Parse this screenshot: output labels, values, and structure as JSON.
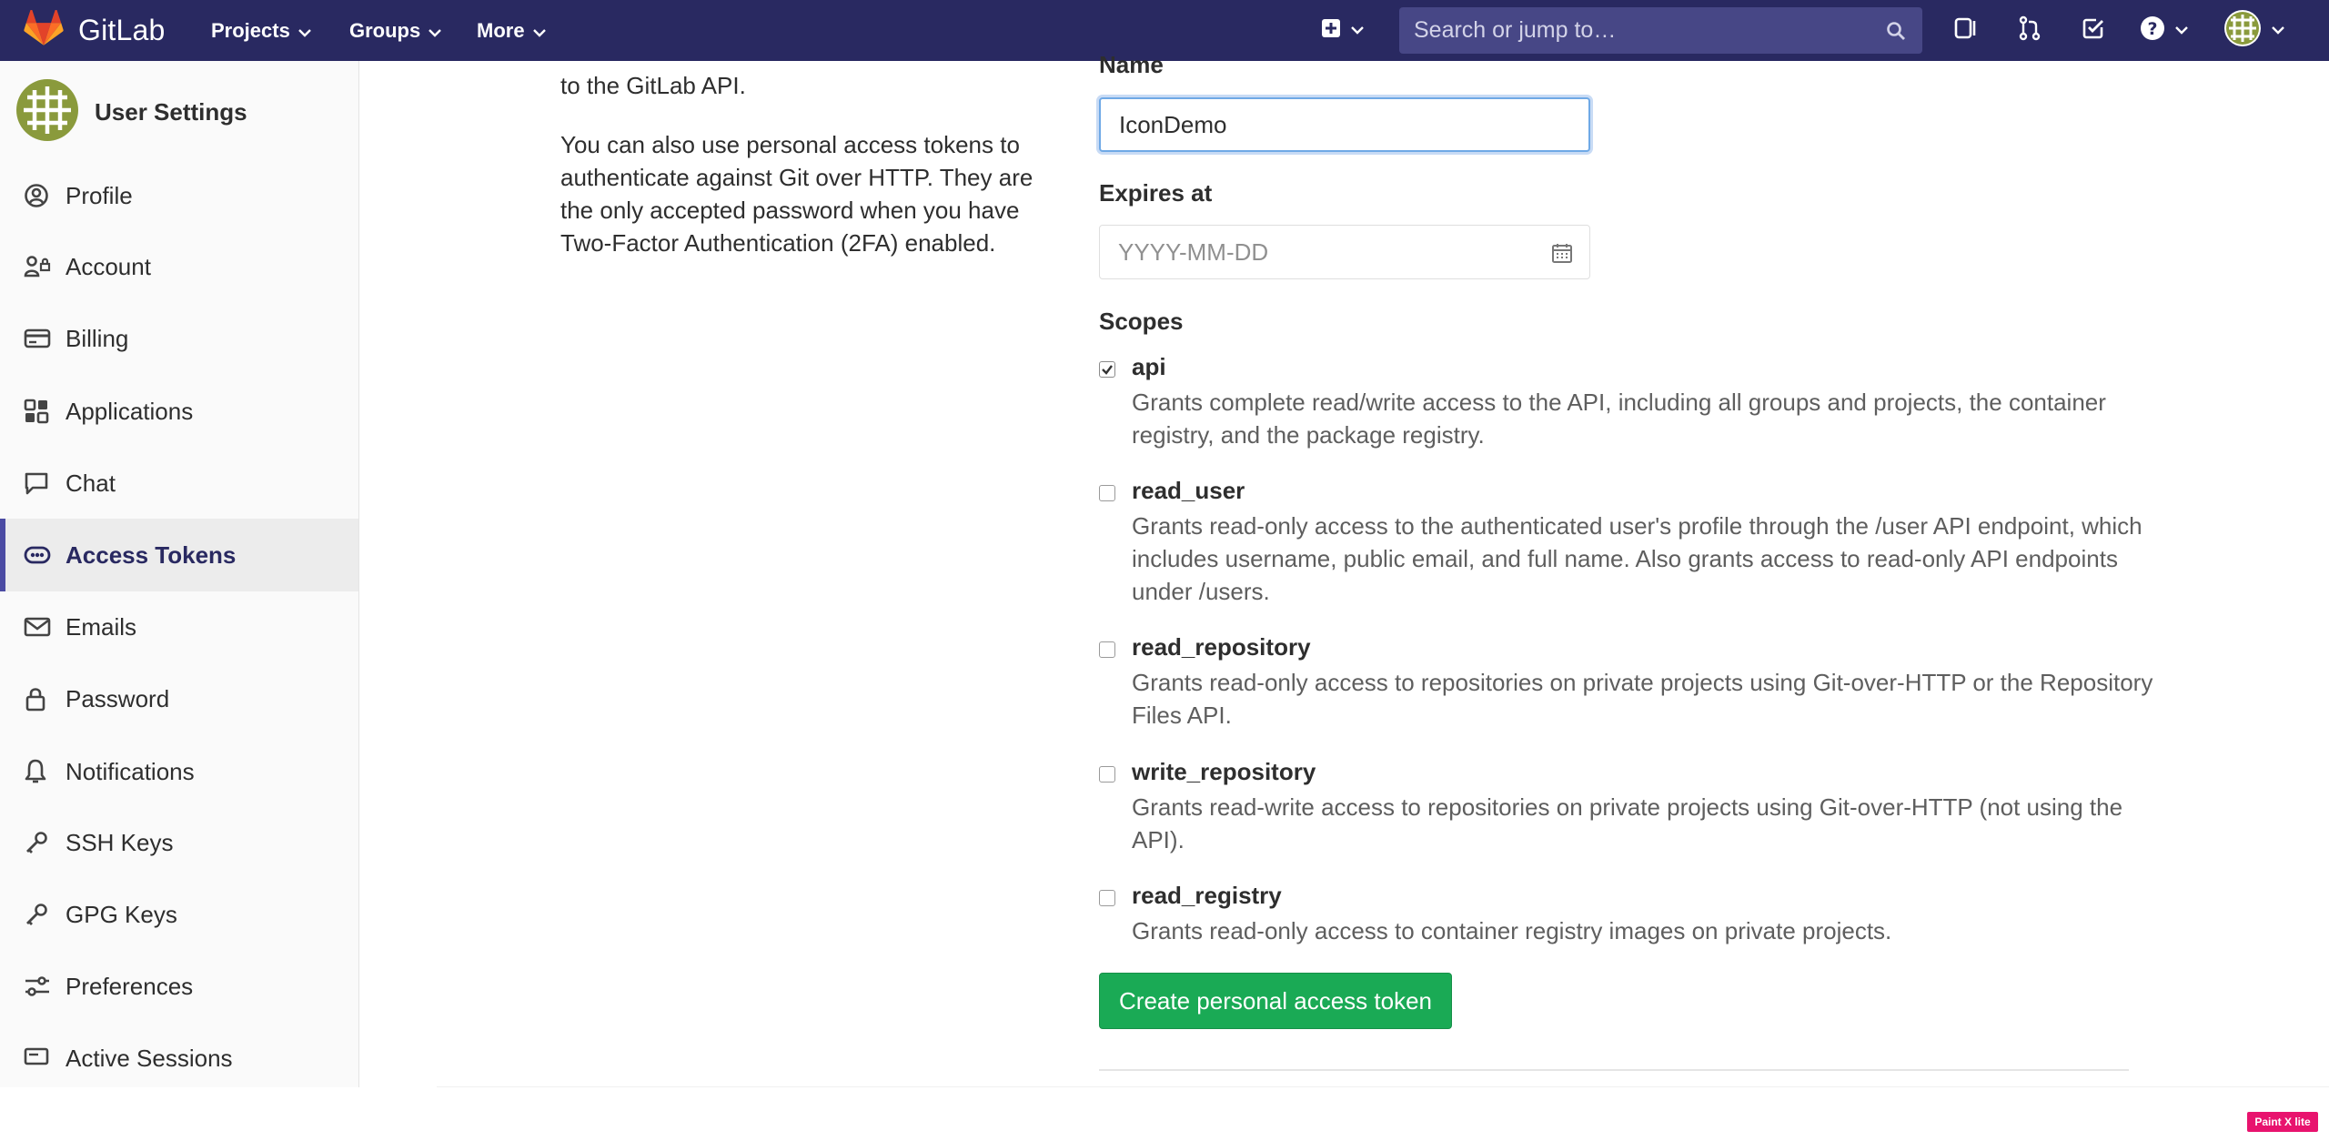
{
  "navbar": {
    "logo_text": "GitLab",
    "projects_label": "Projects",
    "groups_label": "Groups",
    "more_label": "More",
    "search_placeholder": "Search or jump to…",
    "icons": [
      "plus-square-icon",
      "chevron-down-icon",
      "search-icon",
      "sidebar-toggle-icon",
      "merge-request-icon",
      "todo-check-icon",
      "question-icon",
      "user-avatar"
    ],
    "bg_color": "#292961"
  },
  "sidebar": {
    "title": "User Settings",
    "items": [
      {
        "label": "Profile",
        "icon": "profile-icon"
      },
      {
        "label": "Account",
        "icon": "account-icon"
      },
      {
        "label": "Billing",
        "icon": "credit-card-icon"
      },
      {
        "label": "Applications",
        "icon": "applications-icon"
      },
      {
        "label": "Chat",
        "icon": "comment-icon"
      },
      {
        "label": "Access Tokens",
        "icon": "token-icon",
        "active": true
      },
      {
        "label": "Emails",
        "icon": "envelope-icon"
      },
      {
        "label": "Password",
        "icon": "lock-icon"
      },
      {
        "label": "Notifications",
        "icon": "bell-icon"
      },
      {
        "label": "SSH Keys",
        "icon": "key-icon"
      },
      {
        "label": "GPG Keys",
        "icon": "key-icon"
      },
      {
        "label": "Preferences",
        "icon": "preferences-icon"
      },
      {
        "label": "Active Sessions",
        "icon": "monitor-icon"
      }
    ],
    "active_color": "#4b4ba3"
  },
  "intro": {
    "line_top": "to the GitLab API.",
    "paragraph": "You can also use personal access tokens to authenticate against Git over HTTP. They are the only accepted password when you have Two-Factor Authentication (2FA) enabled."
  },
  "form": {
    "name_label": "Name",
    "name_value": "IconDemo",
    "expires_label": "Expires at",
    "expires_placeholder": "YYYY-MM-DD",
    "scopes_label": "Scopes",
    "scopes": [
      {
        "name": "api",
        "checked": true,
        "desc": "Grants complete read/write access to the API, including all groups and projects, the container registry, and the package registry."
      },
      {
        "name": "read_user",
        "checked": false,
        "desc": "Grants read-only access to the authenticated user's profile through the /user API endpoint, which includes username, public email, and full name. Also grants access to read-only API endpoints under /users."
      },
      {
        "name": "read_repository",
        "checked": false,
        "desc": "Grants read-only access to repositories on private projects using Git-over-HTTP or the Repository Files API."
      },
      {
        "name": "write_repository",
        "checked": false,
        "desc": "Grants read-write access to repositories on private projects using Git-over-HTTP (not using the API)."
      },
      {
        "name": "read_registry",
        "checked": false,
        "desc": "Grants read-only access to container registry images on private projects."
      }
    ],
    "submit_label": "Create personal access token",
    "submit_color": "#1aaa55"
  },
  "watermark": "Paint X lite"
}
